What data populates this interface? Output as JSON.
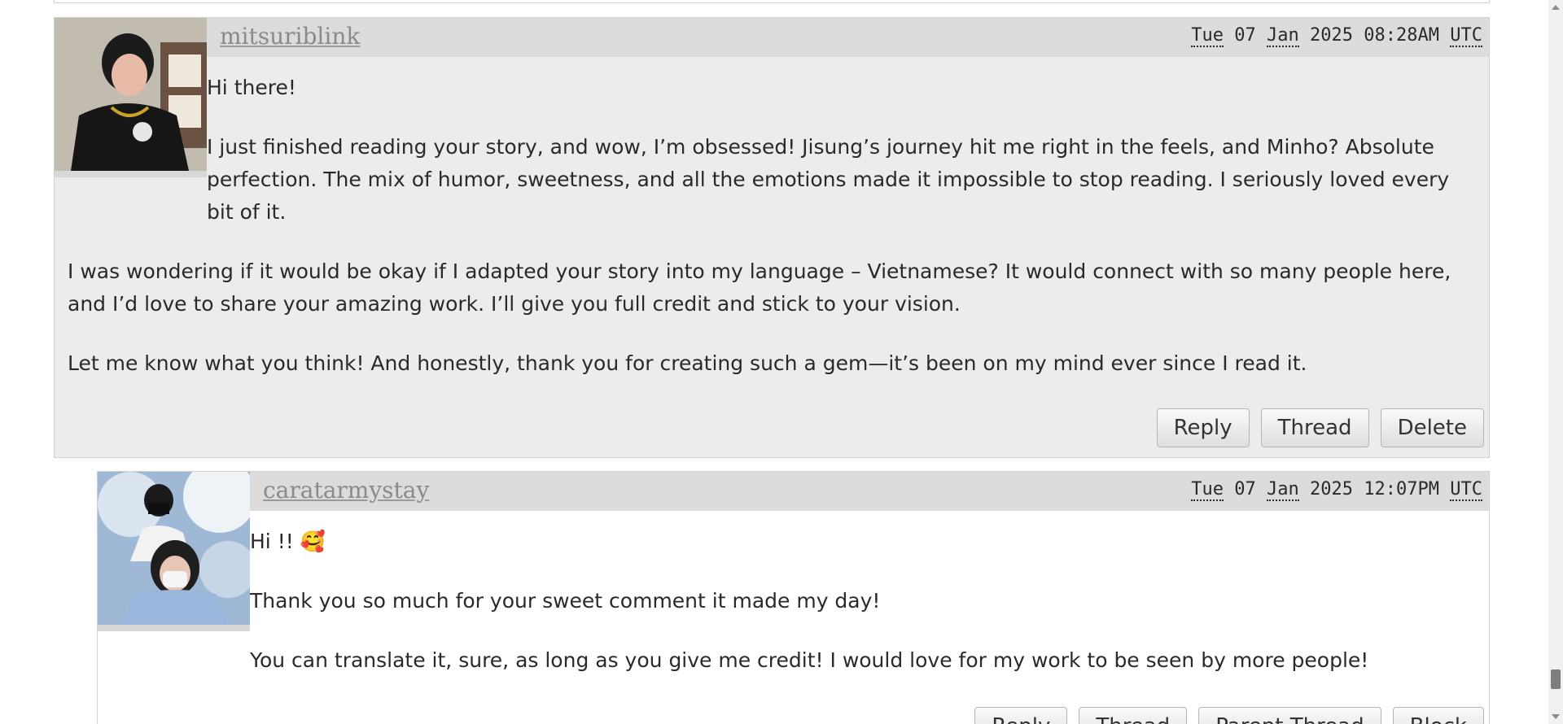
{
  "comments": [
    {
      "username": "mitsuriblink",
      "date": {
        "day": "Tue",
        "daynum": "07",
        "month": "Jan",
        "year": "2025",
        "time": "08:28AM",
        "tz": "UTC"
      },
      "paragraphs": [
        "Hi there!",
        "I just finished reading your story, and wow, I’m obsessed! Jisung’s journey hit me right in the feels, and Minho? Absolute perfection. The mix of humor, sweetness, and all the emotions made it impossible to stop reading. I seriously loved every bit of it.",
        "I was wondering if it would be okay if I adapted your story into my language – Vietnamese? It would connect with so many people here, and I’d love to share your amazing work. I’ll give you full credit and stick to your vision.",
        "Let me know what you think! And honestly, thank you for creating such a gem—it’s been on my mind ever since I read it."
      ],
      "actions": [
        "Reply",
        "Thread",
        "Delete"
      ]
    },
    {
      "username": "caratarmystay",
      "date": {
        "day": "Tue",
        "daynum": "07",
        "month": "Jan",
        "year": "2025",
        "time": "12:07PM",
        "tz": "UTC"
      },
      "paragraphs": [
        "Hi !! 🥰",
        "Thank you so much for your sweet comment it made my day!",
        "You can translate it, sure, as long as you give me credit! I would love for my work to be seen by more people!"
      ],
      "actions": [
        "Reply",
        "Thread",
        "Parent Thread",
        "Block"
      ]
    }
  ],
  "colors": {
    "parent_bg": "#ececec",
    "byline_bg": "#dcdcdc",
    "reply_bg": "#ffffff"
  }
}
